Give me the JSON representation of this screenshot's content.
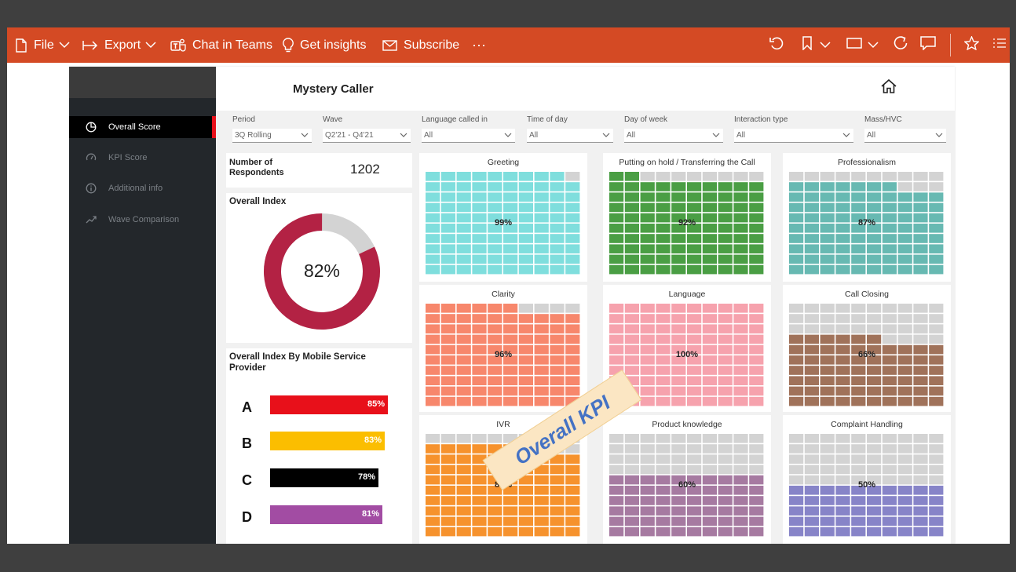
{
  "toolbar": {
    "file": "File",
    "export": "Export",
    "chat_in_teams": "Chat in Teams",
    "get_insights": "Get insights",
    "subscribe": "Subscribe",
    "more": "···"
  },
  "sidebar": {
    "items": [
      {
        "label": "Overall Score",
        "icon": "pie-icon",
        "active": true
      },
      {
        "label": "KPI Score",
        "icon": "gauge-icon",
        "active": false
      },
      {
        "label": "Additional info",
        "icon": "info-icon",
        "active": false
      },
      {
        "label": "Wave Comparison",
        "icon": "trend-icon",
        "active": false
      }
    ]
  },
  "report": {
    "title": "Mystery Caller"
  },
  "filters": [
    {
      "label": "Period",
      "value": "3Q Rolling"
    },
    {
      "label": "Wave",
      "value": "Q2'21 - Q4'21"
    },
    {
      "label": "Language called in",
      "value": "All"
    },
    {
      "label": "Time of day",
      "value": "All"
    },
    {
      "label": "Day of week",
      "value": "All"
    },
    {
      "label": "Interaction type",
      "value": "All"
    },
    {
      "label": "Mass/HVC",
      "value": "All"
    }
  ],
  "respondents": {
    "label": "Number of Respondents",
    "value": "1202"
  },
  "overall_index": {
    "title": "Overall Index",
    "value_label": "82%",
    "value": 0.82,
    "fill_color": "#b32244",
    "rest_color": "#d3d3d3"
  },
  "provider_index": {
    "title": "Overall Index By Mobile Service Provider",
    "bars": [
      {
        "letter": "A",
        "label": "85%",
        "value": 85,
        "color": "#e8101a"
      },
      {
        "letter": "B",
        "label": "83%",
        "value": 83,
        "color": "#fbbe00"
      },
      {
        "letter": "C",
        "label": "78%",
        "value": 78,
        "color": "#000000"
      },
      {
        "letter": "D",
        "label": "81%",
        "value": 81,
        "color": "#a24ca3"
      }
    ]
  },
  "kpis": [
    {
      "title": "Greeting",
      "label": "99%",
      "value": 99,
      "color": "#7fdedd"
    },
    {
      "title": "Putting on hold / Transferring the Call",
      "label": "92%",
      "value": 92,
      "color": "#4a9e44"
    },
    {
      "title": "Professionalism",
      "label": "87%",
      "value": 87,
      "color": "#67b9b2"
    },
    {
      "title": "Clarity",
      "label": "96%",
      "value": 96,
      "color": "#f7876c"
    },
    {
      "title": "Language",
      "label": "100%",
      "value": 100,
      "color": "#f6a2ad"
    },
    {
      "title": "Call Closing",
      "label": "66%",
      "value": 66,
      "color": "#a0725a"
    },
    {
      "title": "IVR",
      "label": "87%",
      "value": 87,
      "color": "#f6922d"
    },
    {
      "title": "Product knowledge",
      "label": "60%",
      "value": 60,
      "color": "#a67aa1"
    },
    {
      "title": "Complaint Handling",
      "label": "50%",
      "value": 50,
      "color": "#8784c8"
    }
  ],
  "overlay": {
    "text": "Overall KPI"
  },
  "colors": {
    "toolbar": "#d44a24",
    "sidebar": "#23272b",
    "active_marker": "#e8101a",
    "empty_cell": "#d3d3d3"
  }
}
